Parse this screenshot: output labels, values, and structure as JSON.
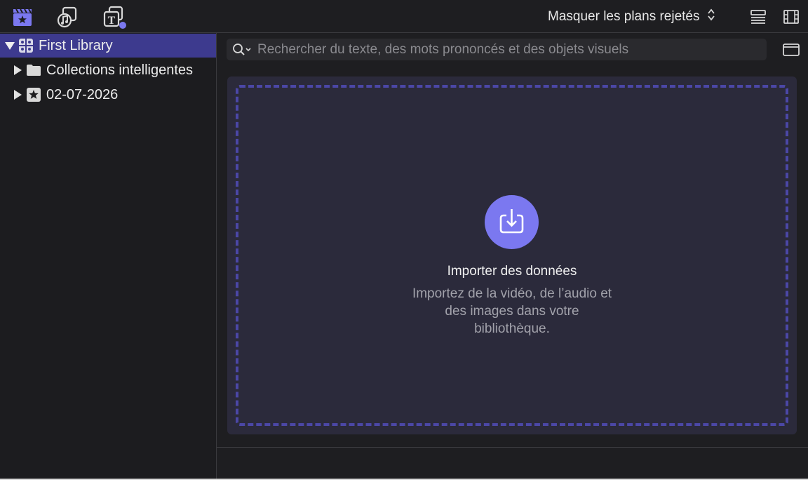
{
  "toolbar": {
    "icons": [
      "libraries-clapper-icon",
      "photos-audio-icon",
      "titles-generators-icon"
    ],
    "filter_label": "Masquer les plans rejetés",
    "filter_icon": "updown-chevron-icon",
    "view_icons": [
      "list-view-icon",
      "filmstrip-view-icon"
    ]
  },
  "sidebar": {
    "items": [
      {
        "label": "First Library",
        "icon": "library-grid-icon",
        "expanded": true,
        "selected": true
      },
      {
        "label": "Collections intelligentes",
        "icon": "folder-icon",
        "expanded": false
      },
      {
        "label": "02-07-2026",
        "icon": "event-star-icon",
        "expanded": false
      }
    ]
  },
  "search": {
    "placeholder": "Rechercher du texte, des mots prononcés et des objets visuels",
    "icon": "search-icon"
  },
  "import": {
    "title": "Importer des données",
    "description": "Importez de la vidéo, de l’audio et des images dans votre bibliothèque.",
    "icon": "import-arrow-icon"
  },
  "colors": {
    "accent": "#7b78f0",
    "selection": "#3d3a8e",
    "dashed_border": "#4b47a6",
    "drop_background": "#2b2a3b"
  }
}
